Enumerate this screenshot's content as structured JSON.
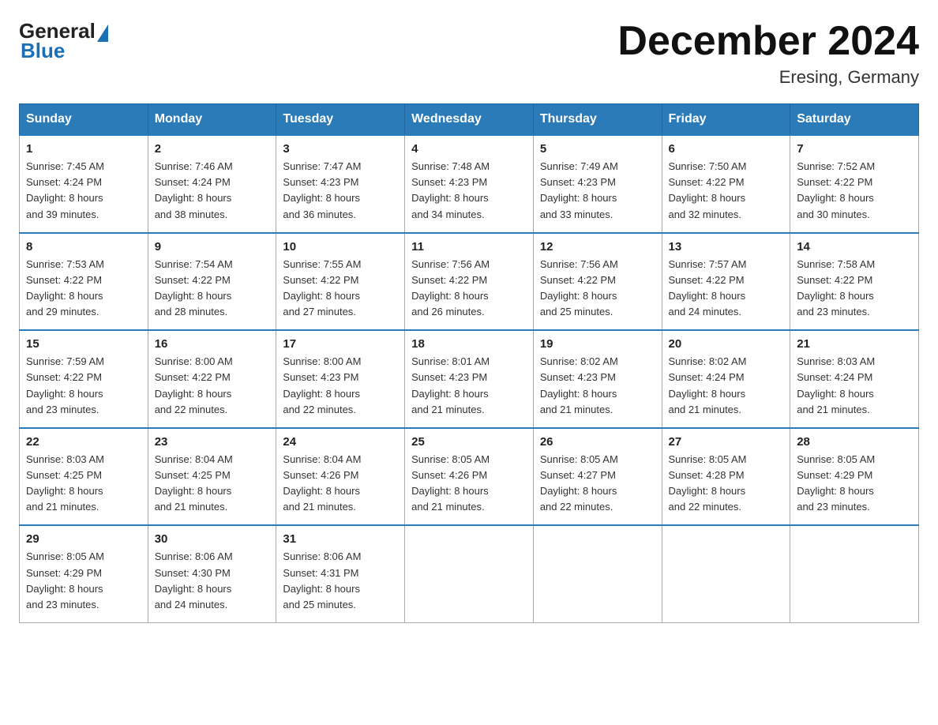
{
  "logo": {
    "general": "General",
    "blue": "Blue"
  },
  "title": "December 2024",
  "subtitle": "Eresing, Germany",
  "days_header": [
    "Sunday",
    "Monday",
    "Tuesday",
    "Wednesday",
    "Thursday",
    "Friday",
    "Saturday"
  ],
  "weeks": [
    [
      {
        "num": "1",
        "sunrise": "7:45 AM",
        "sunset": "4:24 PM",
        "daylight": "8 hours and 39 minutes."
      },
      {
        "num": "2",
        "sunrise": "7:46 AM",
        "sunset": "4:24 PM",
        "daylight": "8 hours and 38 minutes."
      },
      {
        "num": "3",
        "sunrise": "7:47 AM",
        "sunset": "4:23 PM",
        "daylight": "8 hours and 36 minutes."
      },
      {
        "num": "4",
        "sunrise": "7:48 AM",
        "sunset": "4:23 PM",
        "daylight": "8 hours and 34 minutes."
      },
      {
        "num": "5",
        "sunrise": "7:49 AM",
        "sunset": "4:23 PM",
        "daylight": "8 hours and 33 minutes."
      },
      {
        "num": "6",
        "sunrise": "7:50 AM",
        "sunset": "4:22 PM",
        "daylight": "8 hours and 32 minutes."
      },
      {
        "num": "7",
        "sunrise": "7:52 AM",
        "sunset": "4:22 PM",
        "daylight": "8 hours and 30 minutes."
      }
    ],
    [
      {
        "num": "8",
        "sunrise": "7:53 AM",
        "sunset": "4:22 PM",
        "daylight": "8 hours and 29 minutes."
      },
      {
        "num": "9",
        "sunrise": "7:54 AM",
        "sunset": "4:22 PM",
        "daylight": "8 hours and 28 minutes."
      },
      {
        "num": "10",
        "sunrise": "7:55 AM",
        "sunset": "4:22 PM",
        "daylight": "8 hours and 27 minutes."
      },
      {
        "num": "11",
        "sunrise": "7:56 AM",
        "sunset": "4:22 PM",
        "daylight": "8 hours and 26 minutes."
      },
      {
        "num": "12",
        "sunrise": "7:56 AM",
        "sunset": "4:22 PM",
        "daylight": "8 hours and 25 minutes."
      },
      {
        "num": "13",
        "sunrise": "7:57 AM",
        "sunset": "4:22 PM",
        "daylight": "8 hours and 24 minutes."
      },
      {
        "num": "14",
        "sunrise": "7:58 AM",
        "sunset": "4:22 PM",
        "daylight": "8 hours and 23 minutes."
      }
    ],
    [
      {
        "num": "15",
        "sunrise": "7:59 AM",
        "sunset": "4:22 PM",
        "daylight": "8 hours and 23 minutes."
      },
      {
        "num": "16",
        "sunrise": "8:00 AM",
        "sunset": "4:22 PM",
        "daylight": "8 hours and 22 minutes."
      },
      {
        "num": "17",
        "sunrise": "8:00 AM",
        "sunset": "4:23 PM",
        "daylight": "8 hours and 22 minutes."
      },
      {
        "num": "18",
        "sunrise": "8:01 AM",
        "sunset": "4:23 PM",
        "daylight": "8 hours and 21 minutes."
      },
      {
        "num": "19",
        "sunrise": "8:02 AM",
        "sunset": "4:23 PM",
        "daylight": "8 hours and 21 minutes."
      },
      {
        "num": "20",
        "sunrise": "8:02 AM",
        "sunset": "4:24 PM",
        "daylight": "8 hours and 21 minutes."
      },
      {
        "num": "21",
        "sunrise": "8:03 AM",
        "sunset": "4:24 PM",
        "daylight": "8 hours and 21 minutes."
      }
    ],
    [
      {
        "num": "22",
        "sunrise": "8:03 AM",
        "sunset": "4:25 PM",
        "daylight": "8 hours and 21 minutes."
      },
      {
        "num": "23",
        "sunrise": "8:04 AM",
        "sunset": "4:25 PM",
        "daylight": "8 hours and 21 minutes."
      },
      {
        "num": "24",
        "sunrise": "8:04 AM",
        "sunset": "4:26 PM",
        "daylight": "8 hours and 21 minutes."
      },
      {
        "num": "25",
        "sunrise": "8:05 AM",
        "sunset": "4:26 PM",
        "daylight": "8 hours and 21 minutes."
      },
      {
        "num": "26",
        "sunrise": "8:05 AM",
        "sunset": "4:27 PM",
        "daylight": "8 hours and 22 minutes."
      },
      {
        "num": "27",
        "sunrise": "8:05 AM",
        "sunset": "4:28 PM",
        "daylight": "8 hours and 22 minutes."
      },
      {
        "num": "28",
        "sunrise": "8:05 AM",
        "sunset": "4:29 PM",
        "daylight": "8 hours and 23 minutes."
      }
    ],
    [
      {
        "num": "29",
        "sunrise": "8:05 AM",
        "sunset": "4:29 PM",
        "daylight": "8 hours and 23 minutes."
      },
      {
        "num": "30",
        "sunrise": "8:06 AM",
        "sunset": "4:30 PM",
        "daylight": "8 hours and 24 minutes."
      },
      {
        "num": "31",
        "sunrise": "8:06 AM",
        "sunset": "4:31 PM",
        "daylight": "8 hours and 25 minutes."
      },
      null,
      null,
      null,
      null
    ]
  ],
  "labels": {
    "sunrise": "Sunrise:",
    "sunset": "Sunset:",
    "daylight": "Daylight:"
  }
}
